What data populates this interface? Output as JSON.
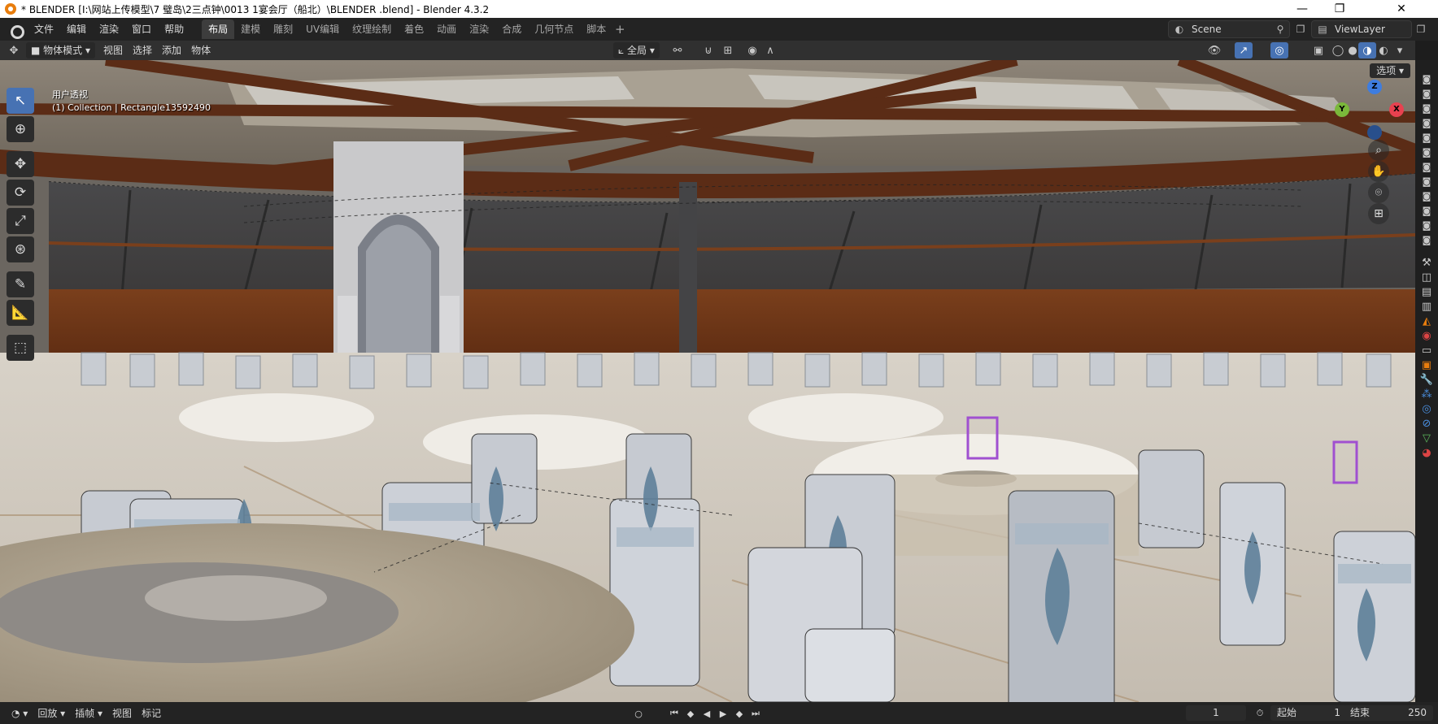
{
  "window": {
    "title": "* BLENDER  [I:\\网站上传模型\\7 璧岛\\2三点钟\\0013 1宴会厅（船北）\\BLENDER .blend] - Blender 4.3.2",
    "minimize": "—",
    "maximize": "❐",
    "close": "✕"
  },
  "menus": [
    "文件",
    "编辑",
    "渲染",
    "窗口",
    "帮助"
  ],
  "workspaces": [
    {
      "label": "布局",
      "active": true
    },
    {
      "label": "建模",
      "active": false
    },
    {
      "label": "雕刻",
      "active": false
    },
    {
      "label": "UV编辑",
      "active": false
    },
    {
      "label": "纹理绘制",
      "active": false
    },
    {
      "label": "着色",
      "active": false
    },
    {
      "label": "动画",
      "active": false
    },
    {
      "label": "渲染",
      "active": false
    },
    {
      "label": "合成",
      "active": false
    },
    {
      "label": "几何节点",
      "active": false
    },
    {
      "label": "脚本",
      "active": false
    }
  ],
  "workspace_add": "+",
  "scene": {
    "label": "Scene"
  },
  "view_layer": {
    "label": "ViewLayer"
  },
  "viewport_header": {
    "mode": "物体模式",
    "menus": [
      "视图",
      "选择",
      "添加",
      "物体"
    ],
    "transform_orientation": "全局",
    "options": "选项"
  },
  "overlay": {
    "view_name": "用户透视",
    "collection_info": "(1) Collection | Rectangle13592490"
  },
  "gizmo": {
    "x": "X",
    "y": "Y",
    "z": "Z"
  },
  "timeline": {
    "playback": "回放",
    "keying": "插帧",
    "view": "视图",
    "marker": "标记",
    "current_frame": "1",
    "start_label": "起始",
    "start_value": "1",
    "end_label": "结束",
    "end_value": "250"
  },
  "colors": {
    "accent": "#4772b3",
    "axis_x": "#e8414f",
    "axis_y": "#7ab83a",
    "axis_z": "#3e7de0",
    "blender_orange": "#e87d0d"
  }
}
